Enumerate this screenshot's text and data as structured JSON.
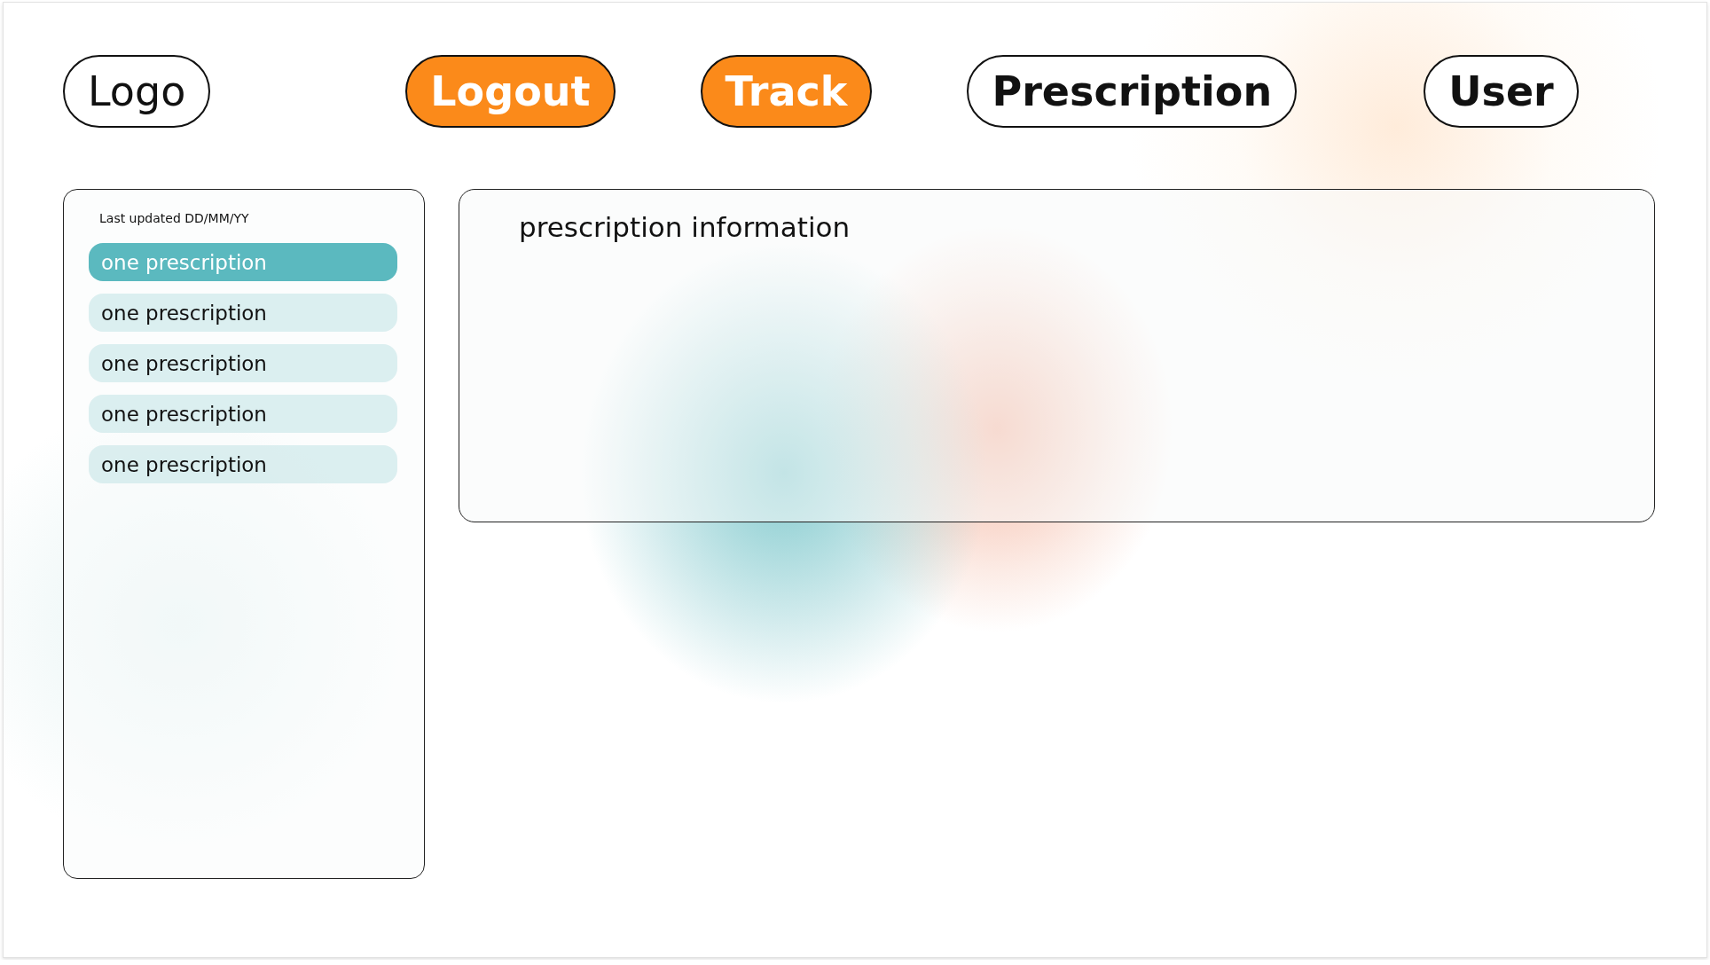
{
  "logo": {
    "label": "Logo"
  },
  "nav": [
    {
      "label": "Logout",
      "filled": true
    },
    {
      "label": "Track",
      "filled": true
    },
    {
      "label": "Prescription",
      "filled": false
    },
    {
      "label": "User",
      "filled": false
    }
  ],
  "sidebar": {
    "updated": "Last updated DD/MM/YY",
    "items": [
      {
        "label": "one prescription",
        "selected": true
      },
      {
        "label": "one prescription",
        "selected": false
      },
      {
        "label": "one prescription",
        "selected": false
      },
      {
        "label": "one prescription",
        "selected": false
      },
      {
        "label": "one prescription",
        "selected": false
      }
    ]
  },
  "main": {
    "title": "prescription information"
  }
}
